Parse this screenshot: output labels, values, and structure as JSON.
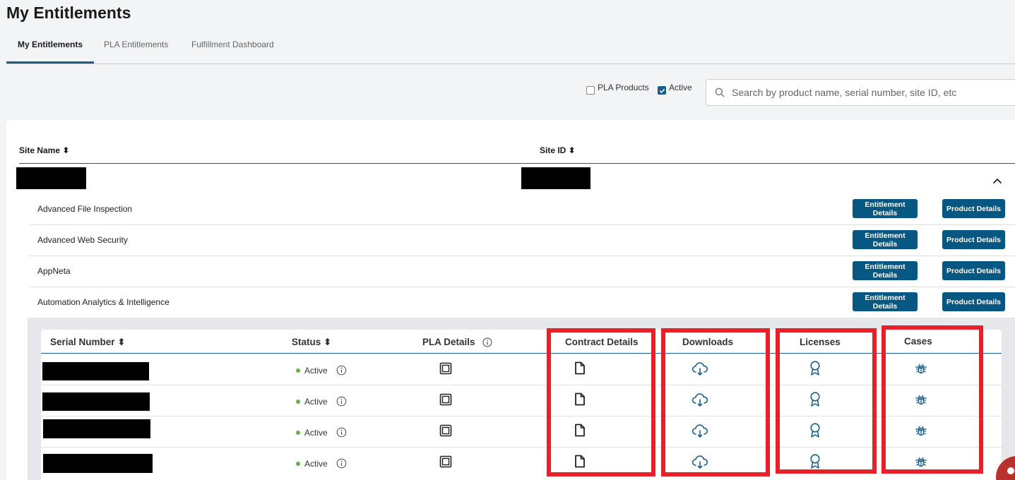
{
  "page": {
    "title": "My Entitlements"
  },
  "tabs": [
    {
      "label": "My Entitlements",
      "active": true
    },
    {
      "label": "PLA Entitlements",
      "active": false
    },
    {
      "label": "Fulfillment Dashboard",
      "active": false
    }
  ],
  "filters": {
    "pla_products": {
      "label": "PLA Products",
      "checked": false
    },
    "active": {
      "label": "Active",
      "checked": true
    }
  },
  "search": {
    "placeholder": "Search by product name, serial number, site ID, etc",
    "value": ""
  },
  "sites_table": {
    "columns": [
      "Site Name ↕",
      "Site ID ↕"
    ],
    "columns_display": [
      "Site Name ⬍",
      "Site ID ⬍"
    ],
    "site_row": {
      "site_name": "[redacted]",
      "site_id": "[redacted]",
      "expanded": true
    }
  },
  "products": [
    {
      "name": "Advanced File Inspection",
      "entitlement_btn": "Entitlement Details",
      "product_btn": "Product Details"
    },
    {
      "name": "Advanced Web Security",
      "entitlement_btn": "Entitlement Details",
      "product_btn": "Product Details"
    },
    {
      "name": "AppNeta",
      "entitlement_btn": "Entitlement Details",
      "product_btn": "Product Details"
    },
    {
      "name": "Automation Analytics & Intelligence",
      "entitlement_btn": "Entitlement Details",
      "product_btn": "Product Details"
    }
  ],
  "serials_table": {
    "headers": {
      "serial_number": "Serial Number ⬍",
      "status": "Status ⬍",
      "pla_details": "PLA Details",
      "contract_details": "Contract Details",
      "downloads": "Downloads",
      "licenses": "Licenses",
      "cases": "Cases"
    },
    "rows": [
      {
        "serial": "[redacted]",
        "status": "Active"
      },
      {
        "serial": "[redacted]",
        "status": "Active"
      },
      {
        "serial": "[redacted]",
        "status": "Active"
      },
      {
        "serial": "[redacted]",
        "status": "Active"
      }
    ]
  },
  "icons": {
    "pla": "copy-squares-icon",
    "contract": "document-icon",
    "downloads": "cloud-download-icon",
    "licenses": "award-ribbon-icon",
    "cases": "bug-icon",
    "info": "info-circle-icon"
  },
  "colors": {
    "accent": "#1b5f8c",
    "button": "#075783",
    "status_active": "#6ab04c",
    "highlight": "#e8202a",
    "icon": "#1b5f8c"
  }
}
